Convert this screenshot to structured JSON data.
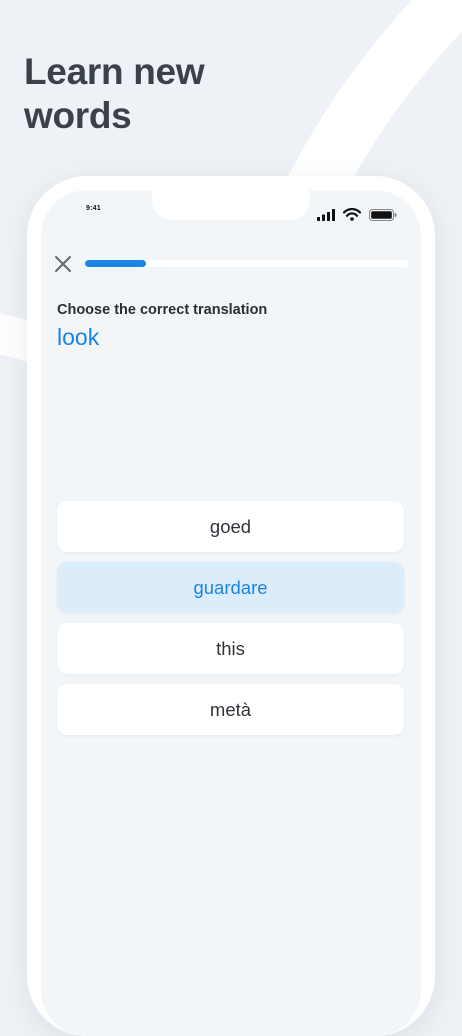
{
  "headline": "Learn new\nwords",
  "status_bar": {
    "time": "9:41"
  },
  "quiz": {
    "progress": 0.19,
    "prompt": "Choose the correct translation",
    "word": "look",
    "options": [
      {
        "label": "goed",
        "selected": false
      },
      {
        "label": "guardare",
        "selected": true
      },
      {
        "label": "this",
        "selected": false
      },
      {
        "label": "metà",
        "selected": false
      }
    ]
  },
  "colors": {
    "accent": "#1a84e6",
    "selected_bg": "#dbecfa",
    "background": "#eef2f6",
    "screen_bg": "#f3f6f9",
    "headline_text": "#3a4149"
  },
  "icons": [
    "close-icon",
    "signal-icon",
    "wifi-icon",
    "battery-icon"
  ]
}
